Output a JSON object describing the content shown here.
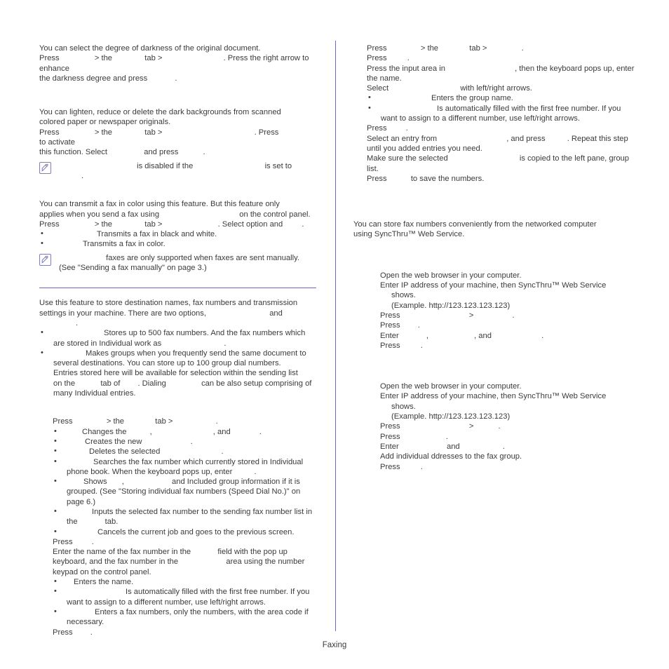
{
  "page": {
    "footer_label": "Faxing",
    "divider_color": "#6f6e9c",
    "text_color": "#3b3b3b"
  },
  "left_column": {
    "darkness_topic": {
      "intro": "You can select the degree of darkness of the original document.",
      "press_lead": "Press",
      "press_mid": "> the",
      "press_tab": "tab >",
      "press_tail": ". Press the right arrow to enhance",
      "line2_lead": "the darkness degree and press",
      "line2_tail": "."
    },
    "background_topic": {
      "intro_line1": "You can lighten, reduce or delete the dark backgrounds from scanned",
      "intro_line2": "colored paper or newspaper originals.",
      "press_lead": "Press",
      "press_mid": "> the",
      "press_tab": "tab >",
      "press_mid2": ". Press",
      "press_tail": "to activate",
      "line2_lead": "this function. Select",
      "line2_mid": "and press",
      "line2_tail": ".",
      "note": {
        "icon": "note-pencil-icon",
        "part1": "is disabled if the",
        "part2": "is set to",
        "part3": "."
      }
    },
    "color_mode_topic": {
      "intro_line1": "You can transmit a fax in color using this feature. But this feature only",
      "intro_line2_lead": "applies when you send a fax using",
      "intro_line2_tail": "on the control panel.",
      "press_lead": "Press",
      "press_mid": "> the",
      "press_tab": "tab >",
      "press_tail": ". Select option and",
      "press_tail2": ".",
      "bullets": [
        "Transmits a fax in black and white.",
        "Transmits a fax in color."
      ],
      "note": {
        "icon": "note-pencil-icon",
        "part1": "faxes are only supported when faxes are sent manually.",
        "part2": "(See \"Sending a fax manually\" on page 3.)"
      }
    },
    "phonebook_topic": {
      "intro_line1": "Use this feature to store destination names, fax numbers and transmission",
      "intro_line2_lead": "settings in your machine. There are two options,",
      "intro_line2_mid": "and",
      "intro_line2_tail": ".",
      "bullets": [
        {
          "line1_tail": "Stores up to 500 fax numbers. And the fax numbers which",
          "line2_lead": "are stored in Individual work as",
          "line2_tail": "."
        },
        {
          "line1_tail": "Makes groups when you frequently send the same document to",
          "line2": "several destinations. You can store up to 100 group dial numbers.",
          "line3": "Entries stored here will be available for selection within the sending list",
          "line4_lead": "on the",
          "line4_mid": "tab of",
          "line4_mid2": ". Dialing",
          "line4_tail": "can be also setup comprising of",
          "line5": "many Individual entries."
        }
      ]
    },
    "individual_procedure": {
      "step1_lead": "Press",
      "step1_mid": "> the",
      "step1_tab": "tab >",
      "step1_tail": ".",
      "bullets": [
        {
          "lead": "Changes the",
          "mid": ",",
          "mid2": ", and",
          "tail": "."
        },
        {
          "lead": "Creates the new",
          "tail": "."
        },
        {
          "lead": "Deletes the selected",
          "tail": "."
        },
        {
          "line1": "Searches the fax number which currently stored in Individual",
          "line2_lead": "phone book. When the keyboard pops up, enter",
          "line2_tail": "."
        },
        {
          "line1_lead": "Shows",
          "line1_mid": ",",
          "line1_tail": "and Included group information if it is",
          "line2": "grouped. (See \"Storing individual fax numbers (Speed Dial No.)\" on",
          "line3": "page 6.)"
        },
        {
          "line1": "Inputs the selected fax number to the sending fax number list in",
          "line2_lead": "the",
          "line2_tail": "tab."
        },
        {
          "lead": "Cancels the current job and goes to the previous screen."
        }
      ],
      "step2_lead": "Press",
      "step2_tail": ".",
      "step3_line1_lead": "Enter the name of the fax number in the",
      "step3_line1_tail": "field with the pop up",
      "step3_line2_lead": "keyboard, and the fax number in the",
      "step3_line2_tail": "area using the number",
      "step3_line3": "keypad on the control panel.",
      "step3_bullets": [
        {
          "tail": "Enters the name."
        },
        {
          "line1": "Is automatically filled with the first free number. If you",
          "line2": "want to assign to a different number, use left/right arrows."
        },
        {
          "line1": "Enters a fax numbers, only the numbers, with the area code if",
          "line2": "necessary."
        }
      ],
      "step4_lead": "Press",
      "step4_tail": "."
    }
  },
  "right_column": {
    "group_procedure": {
      "step1_lead": "Press",
      "step1_mid": "> the",
      "step1_tab": "tab >",
      "step1_tail": ".",
      "step2_lead": "Press",
      "step2_tail": ".",
      "step3_line1_lead": "Press the input area in",
      "step3_line1_tail": ", then the keyboard pops up, enter",
      "step3_line2": "the name.",
      "step4_lead": "Select",
      "step4_tail": "with left/right arrows.",
      "bullets": [
        {
          "tail": "Enters the group name."
        },
        {
          "line1": "Is automatically filled with the first free number. If you",
          "line2": "want to assign to a different number, use left/right arrows."
        }
      ],
      "step5_lead": "Press",
      "step5_tail": ".",
      "step6_line1_lead": "Select an entry from",
      "step6_line1_mid": ", and press",
      "step6_line1_tail": ". Repeat this step",
      "step6_line2": "until you added entries you need.",
      "step7_line1_lead": "Make sure the selected",
      "step7_line1_tail": "is copied to the left pane, group",
      "step7_line2": "list.",
      "step8_lead": "Press",
      "step8_tail": "to save the numbers."
    },
    "syncthru_topic": {
      "intro_line1": "You can store fax numbers conveniently from the networked computer",
      "intro_line2": "using SyncThru™ Web Service."
    },
    "syncthru_individual": {
      "step1": "Open the web browser in your computer.",
      "step2_line1": "Enter IP address of your machine, then SyncThru™ Web Service",
      "step2_line2": "shows.",
      "step2_line3": "(Example. http://123.123.123.123)",
      "step3_lead": "Press",
      "step3_mid": ">",
      "step3_tail": ".",
      "step4_lead": "Press",
      "step4_tail": ".",
      "step5_lead": "Enter",
      "step5_mid": ",",
      "step5_mid2": ", and",
      "step5_tail": ".",
      "step6_lead": "Press",
      "step6_tail": "."
    },
    "syncthru_group": {
      "step1": "Open the web browser in your computer.",
      "step2_line1": "Enter IP address of your machine, then SyncThru™ Web Service",
      "step2_line2": "shows.",
      "step2_line3": "(Example. http://123.123.123.123)",
      "step3_lead": "Press",
      "step3_mid": ">",
      "step3_tail": ".",
      "step4_lead": "Press",
      "step4_tail": ".",
      "step5_lead": "Enter",
      "step5_mid": "and",
      "step5_tail": ".",
      "step6": "Add individual ddresses to the fax group.",
      "step7_lead": "Press",
      "step7_tail": "."
    }
  }
}
